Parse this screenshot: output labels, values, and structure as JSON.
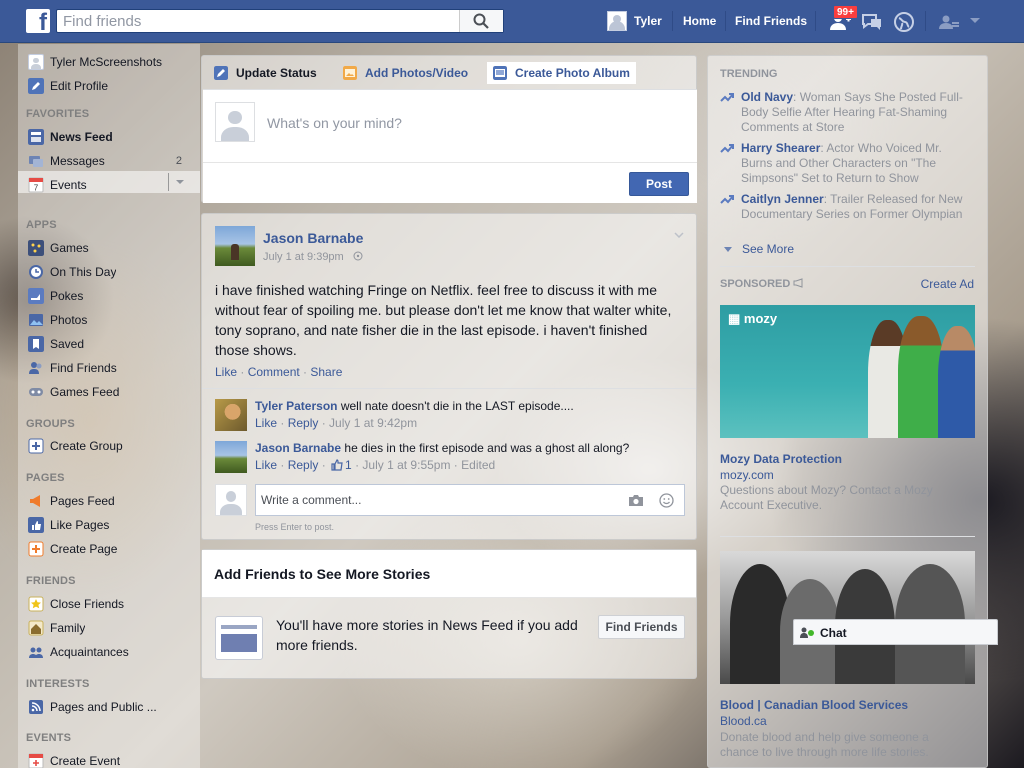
{
  "topbar": {
    "logo": "f",
    "search_placeholder": "Find friends",
    "user_name": "Tyler",
    "home": "Home",
    "find_friends": "Find Friends",
    "notif_count": "99+"
  },
  "left_nav": {
    "profile_name": "Tyler McScreenshots",
    "edit_profile": "Edit Profile",
    "favorites_header": "FAVORITES",
    "favorites": [
      {
        "label": "News Feed",
        "icon": "news-feed-icon"
      },
      {
        "label": "Messages",
        "icon": "messages-icon",
        "count": "2"
      },
      {
        "label": "Events",
        "icon": "calendar-icon",
        "day": "7"
      }
    ],
    "apps_header": "APPS",
    "apps": [
      {
        "label": "Games",
        "icon": "games-icon"
      },
      {
        "label": "On This Day",
        "icon": "clock-icon"
      },
      {
        "label": "Pokes",
        "icon": "poke-icon"
      },
      {
        "label": "Photos",
        "icon": "photos-icon"
      },
      {
        "label": "Saved",
        "icon": "bookmark-icon"
      },
      {
        "label": "Find Friends",
        "icon": "friends-icon"
      },
      {
        "label": "Games Feed",
        "icon": "controller-icon"
      }
    ],
    "groups_header": "GROUPS",
    "create_group": "Create Group",
    "pages_header": "PAGES",
    "pages": [
      {
        "label": "Pages Feed",
        "icon": "megaphone-icon"
      },
      {
        "label": "Like Pages",
        "icon": "thumbs-up-icon"
      },
      {
        "label": "Create Page",
        "icon": "plus-flag-icon"
      }
    ],
    "friends_header": "FRIENDS",
    "friends": [
      {
        "label": "Close Friends",
        "icon": "star-icon"
      },
      {
        "label": "Family",
        "icon": "family-icon"
      },
      {
        "label": "Acquaintances",
        "icon": "acquaintances-icon"
      }
    ],
    "interests_header": "INTERESTS",
    "interests": [
      {
        "label": "Pages and Public ...",
        "icon": "rss-icon"
      }
    ],
    "events_header": "EVENTS",
    "create_event": "Create Event"
  },
  "composer": {
    "tab_status": "Update Status",
    "tab_photos": "Add Photos/Video",
    "tab_album": "Create Photo Album",
    "placeholder": "What's on your mind?",
    "post": "Post"
  },
  "story": {
    "author": "Jason Barnabe",
    "time": "July 1 at 9:39pm",
    "text": "i have finished watching Fringe on Netflix. feel free to discuss it with me without fear of spoiling me. but please don't let me know that walter white, tony soprano, and nate fisher die in the last episode. i haven't finished those shows.",
    "like": "Like",
    "comment": "Comment",
    "share": "Share",
    "comments": [
      {
        "author": "Tyler Paterson",
        "text": "well nate doesn't die in the LAST episode....",
        "like": "Like",
        "reply": "Reply",
        "time": "July 1 at 9:42pm"
      },
      {
        "author": "Jason Barnabe",
        "text": "he dies in the first episode and was a ghost all along?",
        "like": "Like",
        "reply": "Reply",
        "likes": "1",
        "time": "July 1 at 9:55pm",
        "edited": "Edited"
      }
    ],
    "write_placeholder": "Write a comment...",
    "press_enter": "Press Enter to post."
  },
  "add_friends": {
    "title": "Add Friends to See More Stories",
    "text": "You'll have more stories in News Feed if you add more friends.",
    "button": "Find Friends"
  },
  "right_col": {
    "trending_header": "TRENDING",
    "trending": [
      {
        "title": "Old Navy",
        "text": ": Woman Says She Posted Full-Body Selfie After Hearing Fat-Shaming Comments at Store"
      },
      {
        "title": "Harry Shearer",
        "text": ": Actor Who Voiced Mr. Burns and Other Characters on \"The Simpsons\" Set to Return to Show"
      },
      {
        "title": "Caitlyn Jenner",
        "text": ": Trailer Released for New Documentary Series on Former Olympian"
      }
    ],
    "see_more": "See More",
    "sponsored_header": "SPONSORED",
    "create_ad": "Create Ad",
    "ads": [
      {
        "logo": "mozy",
        "title": "Mozy Data Protection",
        "domain": "mozy.com",
        "desc": "Questions about Mozy? Contact a Mozy Account Executive."
      },
      {
        "title": "Blood | Canadian Blood Services",
        "domain": "Blood.ca",
        "desc": "Donate blood and help give someone a chance to live through more life stories."
      }
    ]
  },
  "chat": {
    "label": "Chat"
  },
  "colors": {
    "brand": "#3b5998",
    "link": "#3b5998",
    "muted": "#90949c",
    "badge": "#fa3e3e",
    "online": "#42b72a"
  }
}
